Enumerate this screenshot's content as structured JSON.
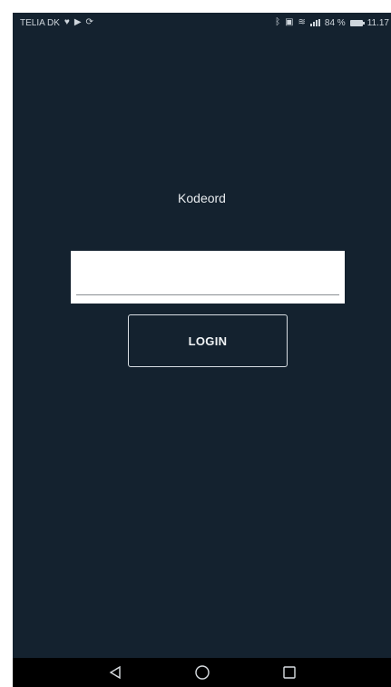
{
  "status_bar": {
    "carrier": "TELIA DK",
    "left_icons": [
      "heart-icon",
      "play-store-icon",
      "sync-icon"
    ],
    "right_icons": [
      "bluetooth-icon",
      "nfc-icon",
      "wifi-icon",
      "signal-icon"
    ],
    "battery_percent": "84 %",
    "time": "11.17"
  },
  "login": {
    "prompt_label": "Kodeord",
    "password_value": "",
    "button_label": "LOGIN"
  },
  "nav_bar": {
    "buttons": [
      "back-icon",
      "home-icon",
      "recent-apps-icon"
    ]
  },
  "colors": {
    "background": "#14222f",
    "nav_background": "#000000",
    "input_background": "#ffffff",
    "text": "#e8ecef"
  }
}
